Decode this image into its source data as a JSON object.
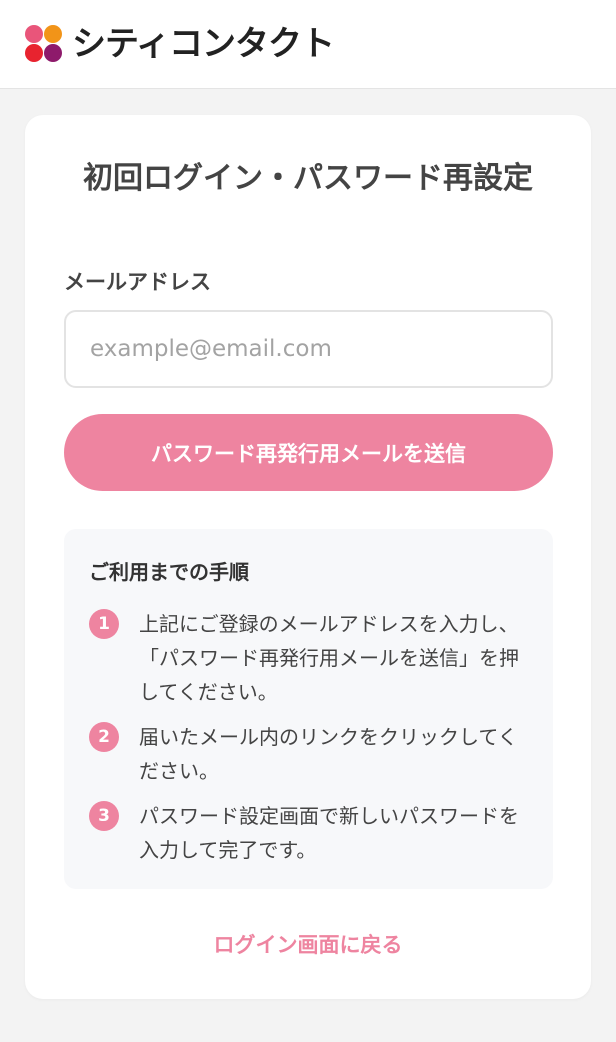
{
  "header": {
    "brand_name": "シティコンタクト",
    "logo_colors": [
      "#e9557a",
      "#f29418",
      "#e8232f",
      "#8e1a6b"
    ]
  },
  "form": {
    "title": "初回ログイン・パスワード再設定",
    "email_label": "メールアドレス",
    "email_placeholder": "example@email.com",
    "email_value": "",
    "submit_label": "パスワード再発行用メールを送信"
  },
  "steps": {
    "title": "ご利用までの手順",
    "items": [
      {
        "number": "1",
        "text": "上記にご登録のメールアドレスを入力し、「パスワード再発行用メールを送信」を押してください。"
      },
      {
        "number": "2",
        "text": "届いたメール内のリンクをクリックしてください。"
      },
      {
        "number": "3",
        "text": "パスワード設定画面で新しいパスワードを入力して完了です。"
      }
    ]
  },
  "back_link_label": "ログイン画面に戻る",
  "colors": {
    "accent": "#ee84a0",
    "background": "#f3f3f3",
    "panel": "#f7f8fa"
  }
}
